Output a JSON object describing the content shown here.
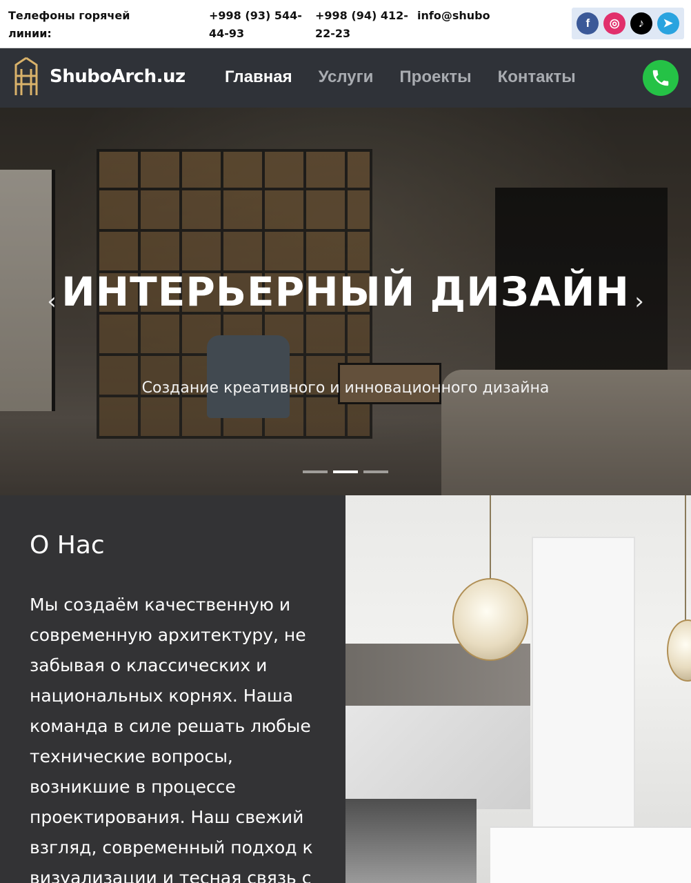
{
  "topbar": {
    "hotline_label": "Телефоны горячей линии:",
    "phone1": "+998 (93) 544-44-93",
    "phone2": "+998 (94) 412-22-23",
    "email": "info@shubo"
  },
  "socials": {
    "facebook_glyph": "f",
    "instagram_glyph": "◎",
    "tiktok_glyph": "♪",
    "telegram_glyph": "➤"
  },
  "nav": {
    "logo_text": "ShuboArch.uz",
    "items": [
      "Главная",
      "Услуги",
      "Проекты",
      "Контакты"
    ],
    "active": "Главная"
  },
  "hero": {
    "title": "ИНТЕРЬЕРНЫЙ ДИЗАЙН",
    "subtitle": "Создание креативного и инновационного дизайна",
    "prev_glyph": "‹",
    "next_glyph": "›",
    "slides_total": 3,
    "active_slide": 2
  },
  "about": {
    "heading": "О Нас",
    "text": "Мы создаём качественную и современную архитектуру, не забывая о классических и национальных корнях. Наша команда в силе решать любые технические вопросы, возникшие в процессе проектирования. Наш свежий взгляд, современный подход к визуализации и тесная связь с"
  },
  "colors": {
    "nav_bg": "#2f3238",
    "about_bg": "#333335",
    "call_green": "#25c246",
    "facebook": "#3b5998",
    "instagram": "#e1306c",
    "telegram": "#2aa3df"
  }
}
